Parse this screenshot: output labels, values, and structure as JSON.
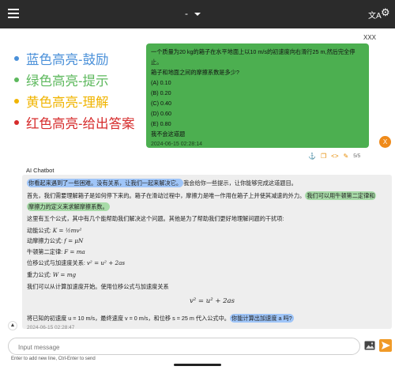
{
  "topbar": {
    "title": "-",
    "translate_icon": "translate-icon",
    "settings_icon": "gear-icon",
    "menu_icon": "hamburger-menu-icon"
  },
  "legend": [
    {
      "label": "蓝色高亮-鼓励",
      "color": "#4a90d9"
    },
    {
      "label": "绿色高亮-提示",
      "color": "#5cb85c"
    },
    {
      "label": "黄色高亮-理解",
      "color": "#f0b400"
    },
    {
      "label": "红色高亮-给出答案",
      "color": "#d62b2b"
    }
  ],
  "user_message": {
    "sender": "XXX",
    "lines": [
      "一个质量为20 kg的箱子在水平地面上以10 m/s的初速度向右滑行25 m,然后完全停止。",
      "箱子和地面之间的摩擦系数是多少?",
      "(A) 0.10",
      "(B) 0.20",
      "(C) 0.40",
      "(D) 0.60",
      "(E) 0.80",
      "我不会这道题"
    ],
    "time": "2024-06-15 02:28:14",
    "avatar_letter": "X",
    "pager": "5/5"
  },
  "bot_message": {
    "sender": "AI Chatbot",
    "p1_blue": "你看起来遇到了一些困难。没有关系，让我们一起来解决它。",
    "p1_rest": "我会给你一些提示，让你能够完成这道题目。",
    "p2_pre": "首先，我们需要理解箱子是如何停下来的。箱子在滑动过程中，摩擦力是唯一作用在箱子上并使其减速的外力。",
    "p2_green_a": "我们可以用牛顿第二定律和",
    "p2_green_b": "摩擦力的定义来求解摩擦系数。",
    "p3": "这里有五个公式，其中有几个能帮助我们解决这个问题。其他是为了帮助我们更好地理解问题的干扰项:",
    "f1_label": "动能公式:",
    "f1": "K = ½mv²",
    "f2_label": "动摩擦力公式:",
    "f2": "f = μN",
    "f3_label": "牛顿第二定律:",
    "f3": "F = ma",
    "f4_label": "位移公式与加速度关系:",
    "f4": "v² = u² + 2as",
    "f5_label": "重力公式:",
    "f5": "W = mg",
    "p4": "我们可以从计算加速度开始。使用位移公式与加速度关系",
    "display_eq": "v² = u² + 2as",
    "p5_pre": "将已知的初速度 u = 10 m/s，最终速度 v = 0 m/s，和位移 s = 25 m 代入公式中。",
    "p5_blue": "你能计算出加速度 a 吗?",
    "time": "2024-06-15 02:28:47"
  },
  "composer": {
    "placeholder": "Input message",
    "hint": "Enter to add new line, Ctrl-Enter to send"
  }
}
